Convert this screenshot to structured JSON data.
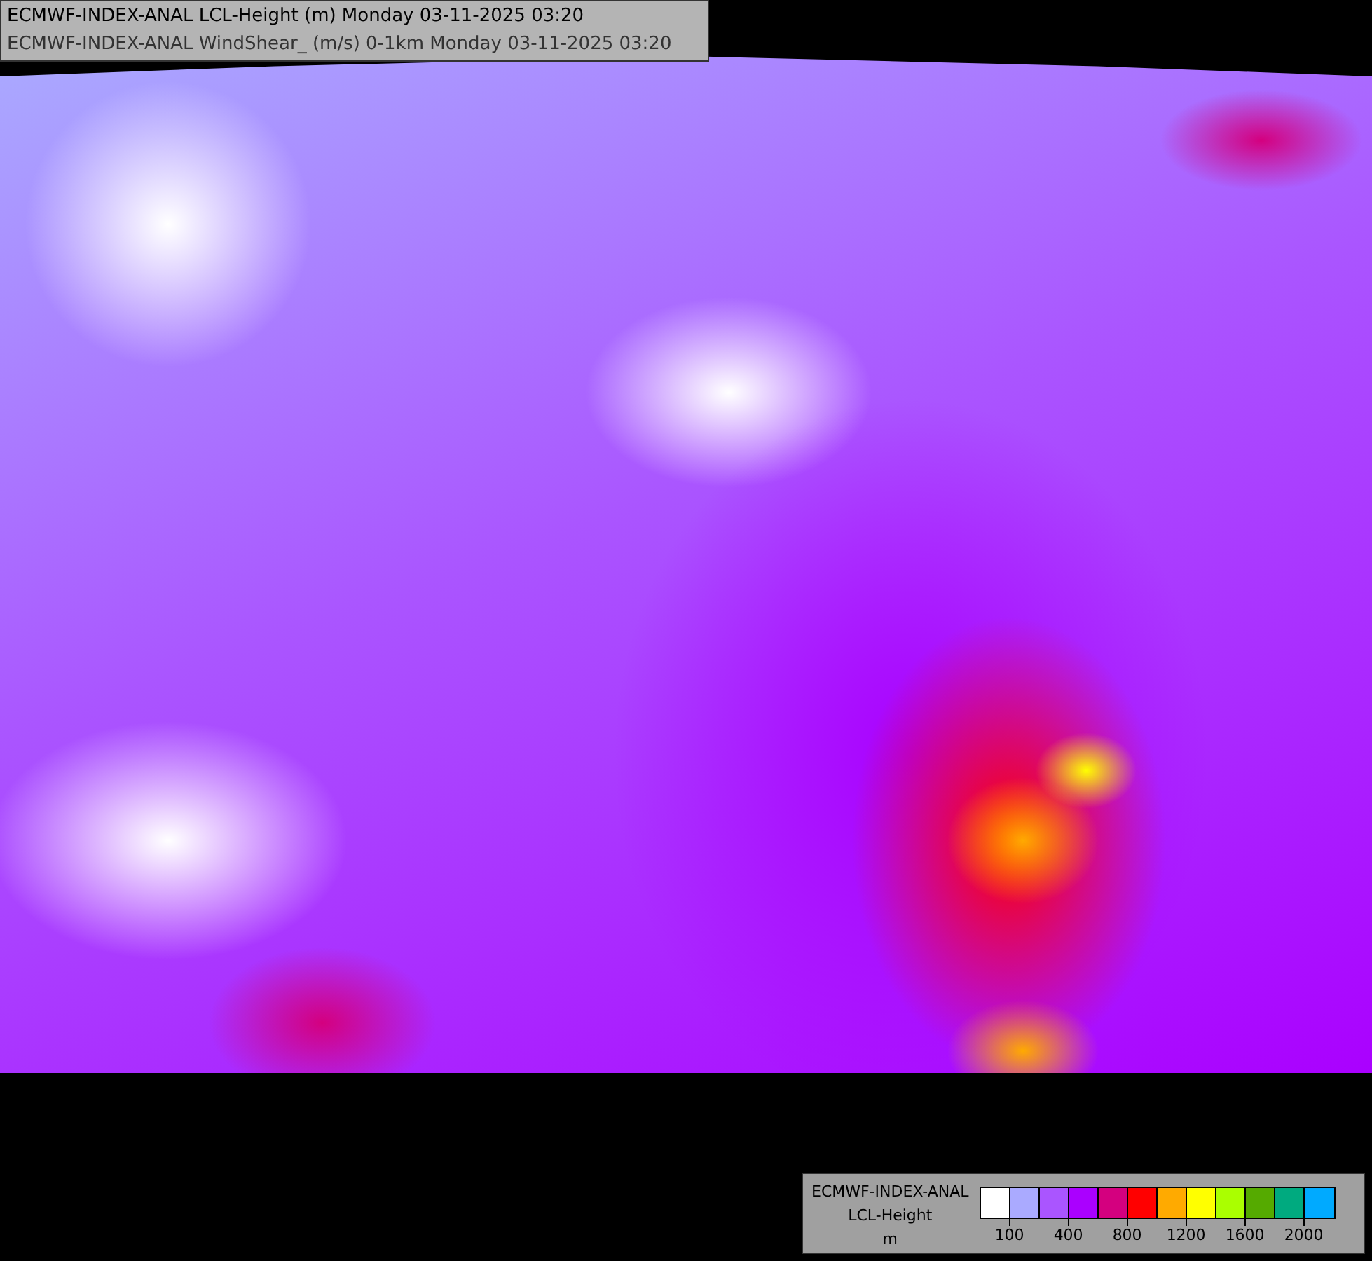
{
  "title_lines": [
    "ECMWF-INDEX-ANAL LCL-Height (m) Monday 03-11-2025 03:20",
    "ECMWF-INDEX-ANAL WindShear_ (m/s) 0-1km Monday 03-11-2025 03:20"
  ],
  "legend": {
    "title_lines": [
      "ECMWF-INDEX-ANAL",
      "LCL-Height",
      "m"
    ],
    "swatches": [
      {
        "color": "#ffffff"
      },
      {
        "color": "#aaaaff"
      },
      {
        "color": "#aa55ff"
      },
      {
        "color": "#aa00ff"
      },
      {
        "color": "#d4007f"
      },
      {
        "color": "#ff0000"
      },
      {
        "color": "#ffaa00"
      },
      {
        "color": "#ffff00"
      },
      {
        "color": "#aaff00"
      },
      {
        "color": "#55aa00"
      },
      {
        "color": "#00aa7f"
      },
      {
        "color": "#00aaff"
      }
    ],
    "tick_labels": [
      "100",
      "400",
      "800",
      "1200",
      "1600",
      "2000"
    ]
  }
}
